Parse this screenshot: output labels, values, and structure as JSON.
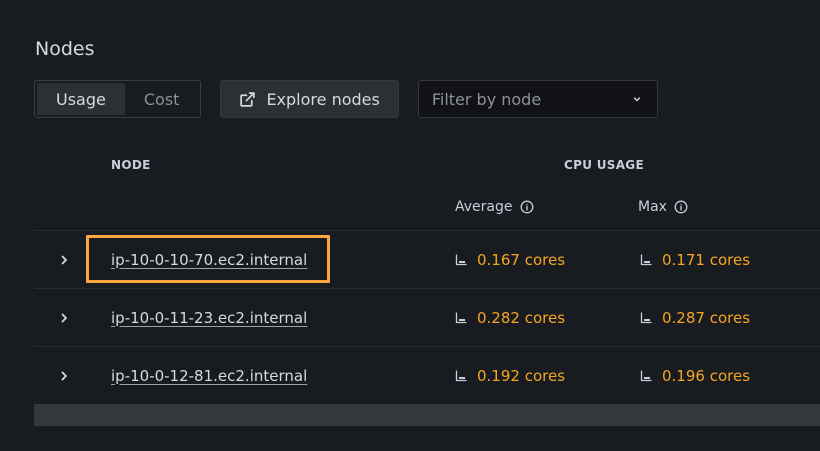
{
  "header": {
    "title": "Nodes"
  },
  "toolbar": {
    "segments": [
      {
        "label": "Usage",
        "active": true
      },
      {
        "label": "Cost",
        "active": false
      }
    ],
    "explore_label": "Explore nodes",
    "filter_placeholder": "Filter by node"
  },
  "table": {
    "col_node": "NODE",
    "col_cpu": "CPU USAGE",
    "sub_average": "Average",
    "sub_max": "Max",
    "rows": [
      {
        "node": "ip-10-0-10-70.ec2.internal",
        "avg": "0.167 cores",
        "max": "0.171 cores"
      },
      {
        "node": "ip-10-0-11-23.ec2.internal",
        "avg": "0.282 cores",
        "max": "0.287 cores"
      },
      {
        "node": "ip-10-0-12-81.ec2.internal",
        "avg": "0.192 cores",
        "max": "0.196 cores"
      }
    ]
  },
  "colors": {
    "background": "#181b1f",
    "value": "#f5a623",
    "highlight": "#ffa641"
  },
  "icons": {
    "explore": "external-link-icon",
    "select": "chevron-down-icon",
    "info": "info-icon",
    "expand": "chevron-right-icon",
    "value": "gauge-icon"
  }
}
